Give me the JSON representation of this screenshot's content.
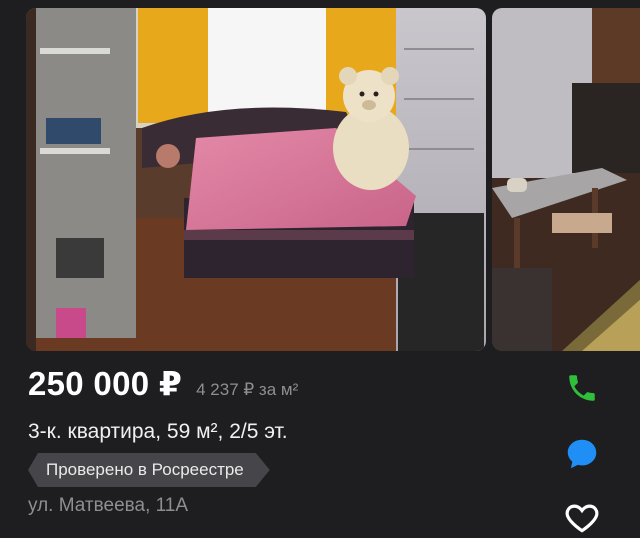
{
  "listing": {
    "price": "250 000 ₽",
    "price_per_m": "4 237 ₽ за м²",
    "title": "3-к. квартира, 59 м², 2/5 эт.",
    "badge": "Проверено в Росреестре",
    "address": "ул. Матвеева, 11А"
  },
  "colors": {
    "background": "#1e1e20",
    "call_accent": "#2fbf3a",
    "message_accent": "#1f8ff5",
    "badge_bg": "#46464a"
  },
  "icons": [
    "phone-icon",
    "chat-bubble-icon",
    "heart-icon"
  ]
}
